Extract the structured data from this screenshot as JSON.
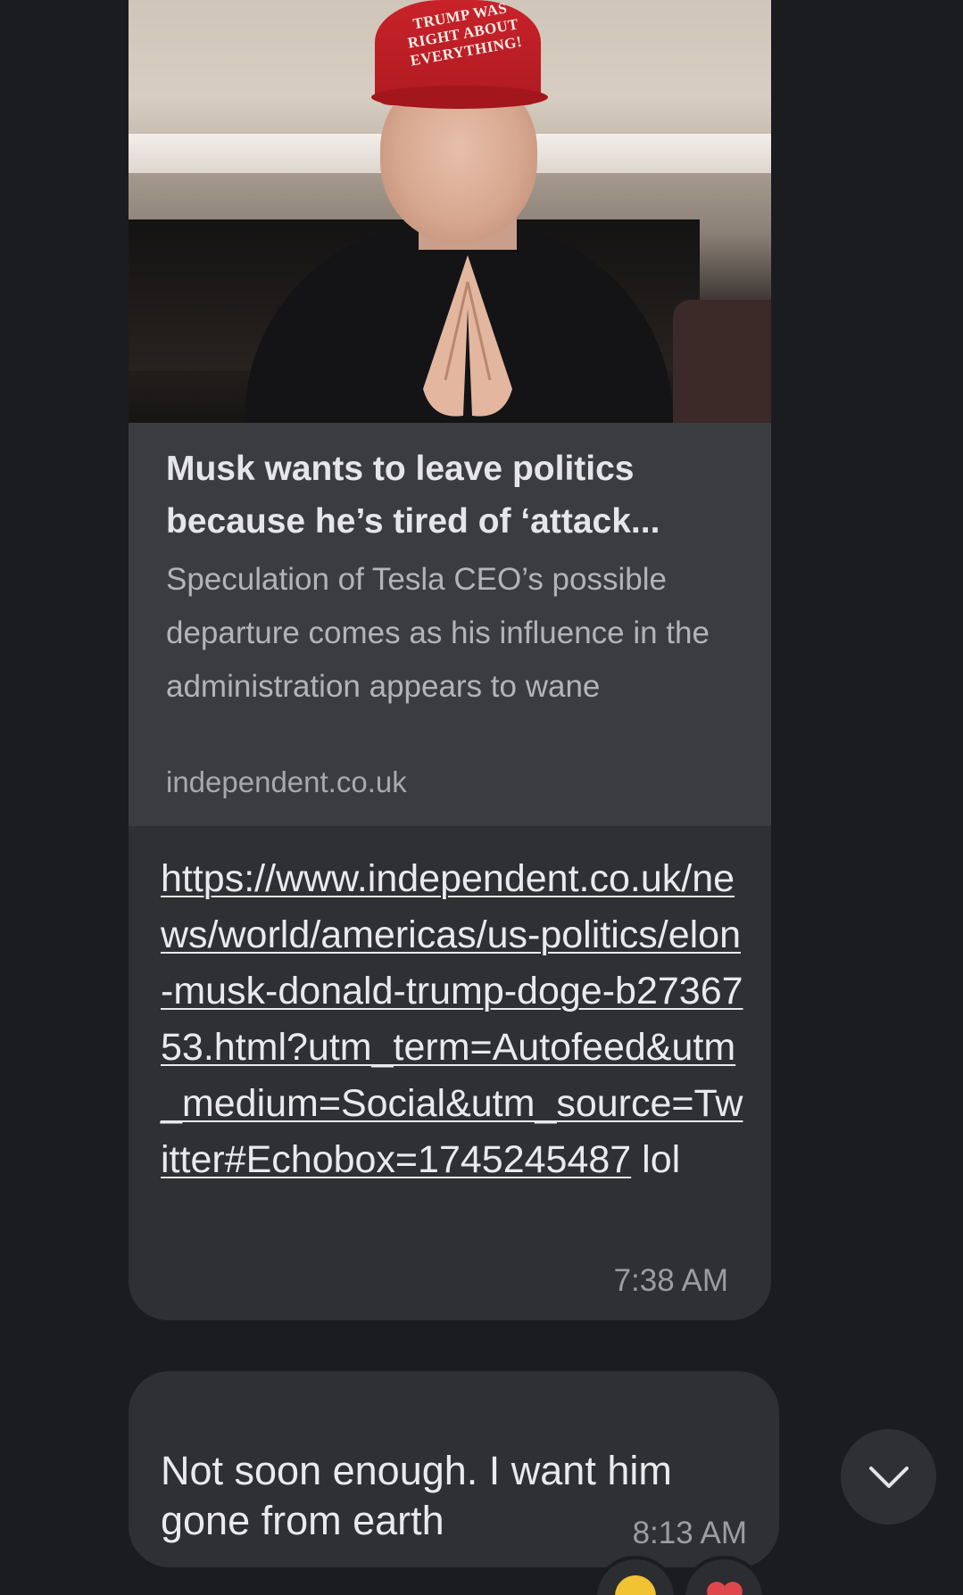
{
  "preview": {
    "cap_lines": [
      "TRUMP WAS",
      "RIGHT ABOUT",
      "EVERYTHING!"
    ],
    "title": "Musk wants to leave politics because he’s tired of ‘attack...",
    "description": "Speculation of Tesla CEO’s possible departure comes as his influence in the administration appears to wane",
    "domain": "independent.co.uk"
  },
  "message_1": {
    "link": "https://www.independent.co.uk/news/world/americas/us-politics/elon-musk-donald-trump-doge-b2736753.html?utm_term=Autofeed&utm_medium=Social&utm_source=Twitter#Echobox=1745245487",
    "suffix": " lol",
    "time": "7:38 AM"
  },
  "message_2": {
    "text": "Not soon enough. I want him gone from earth",
    "time": "8:13 AM",
    "reactions": [
      "smiley-face-emoji",
      "heart-emoji"
    ]
  },
  "colors": {
    "background": "#1b1c20",
    "bubble": "#2f3033",
    "preview_meta": "#3b3c40",
    "text": "#eaeaec",
    "muted": "#9c9da1"
  },
  "icons": {
    "scroll_button": "chevron-down-icon"
  }
}
